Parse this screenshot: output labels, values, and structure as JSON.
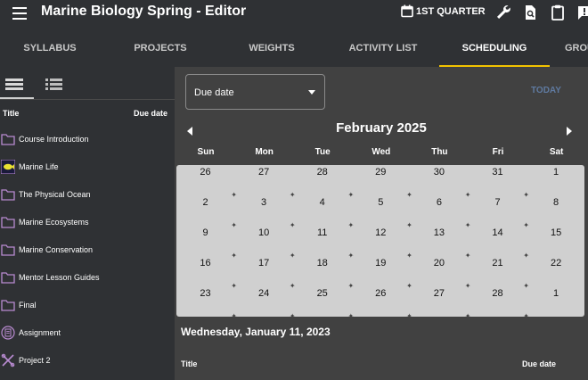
{
  "header": {
    "title": "Marine Biology Spring - Editor",
    "quarter_label": "1ST QUARTER"
  },
  "tabs": [
    {
      "label": "SYLLABUS",
      "active": false
    },
    {
      "label": "PROJECTS",
      "active": false
    },
    {
      "label": "WEIGHTS",
      "active": false
    },
    {
      "label": "ACTIVITY LIST",
      "active": false
    },
    {
      "label": "SCHEDULING",
      "active": true
    },
    {
      "label": "GROU",
      "active": false
    }
  ],
  "left_panel": {
    "columns": {
      "title": "Title",
      "due": "Due date"
    },
    "items": [
      {
        "label": "Course Introduction",
        "icon": "folder-icon"
      },
      {
        "label": "Marine Life",
        "icon": "fish-thumbnail"
      },
      {
        "label": "The Physical Ocean",
        "icon": "folder-icon"
      },
      {
        "label": "Marine Ecosystems",
        "icon": "folder-icon"
      },
      {
        "label": "Marine Conservation",
        "icon": "folder-icon"
      },
      {
        "label": "Mentor Lesson Guides",
        "icon": "folder-icon"
      },
      {
        "label": "Final",
        "icon": "folder-icon"
      },
      {
        "label": "Assignment",
        "icon": "assignment-icon"
      },
      {
        "label": "Project 2",
        "icon": "project-icon"
      }
    ]
  },
  "scheduling": {
    "sort_select": {
      "value": "Due date"
    },
    "today_label": "TODAY",
    "month_title": "February 2025",
    "weekdays": [
      "Sun",
      "Mon",
      "Tue",
      "Wed",
      "Thu",
      "Fri",
      "Sat"
    ],
    "weeks": [
      [
        "26",
        "27",
        "28",
        "29",
        "30",
        "31",
        "1"
      ],
      [
        "2",
        "3",
        "4",
        "5",
        "6",
        "7",
        "8"
      ],
      [
        "9",
        "10",
        "11",
        "12",
        "13",
        "14",
        "15"
      ],
      [
        "16",
        "17",
        "18",
        "19",
        "20",
        "21",
        "22"
      ],
      [
        "23",
        "24",
        "25",
        "26",
        "27",
        "28",
        "1"
      ]
    ],
    "selected_date": "Wednesday, January 11, 2023",
    "columns": {
      "title": "Title",
      "due": "Due date"
    }
  },
  "colors": {
    "accent": "#f2c200",
    "today": "#5f7aa0",
    "folder": "#b98bd1",
    "calendar_bg": "#d0d0d0"
  }
}
